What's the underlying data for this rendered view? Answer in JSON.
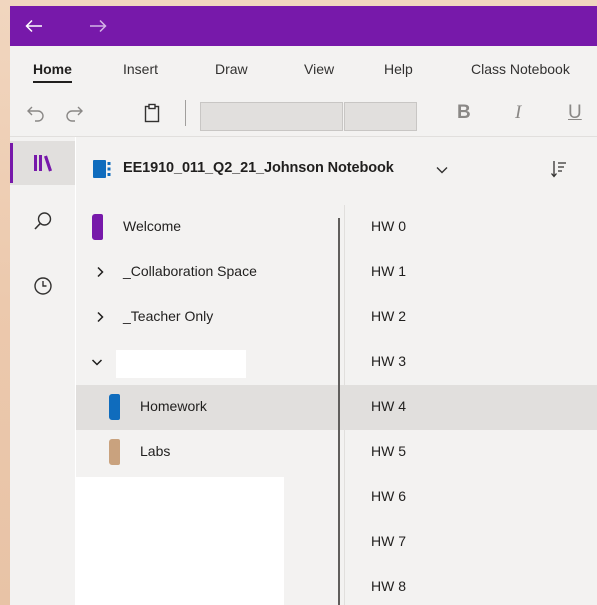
{
  "nav": {
    "back_icon": "arrow-left-icon",
    "forward_icon": "arrow-right-icon"
  },
  "ribbon": {
    "tabs": [
      {
        "label": "Home",
        "active": true
      },
      {
        "label": "Insert"
      },
      {
        "label": "Draw"
      },
      {
        "label": "View"
      },
      {
        "label": "Help"
      },
      {
        "label": "Class Notebook"
      }
    ]
  },
  "toolbar": {
    "undo_icon": "undo-icon",
    "redo_icon": "redo-icon",
    "paste_icon": "clipboard-icon",
    "font_name": "",
    "font_size": "",
    "bold_label": "B",
    "italic_label": "I",
    "underline_label": "U"
  },
  "rail": {
    "items": [
      {
        "icon": "notebooks-icon",
        "active": true
      },
      {
        "icon": "search-icon"
      },
      {
        "icon": "recent-clock-icon"
      }
    ]
  },
  "notebook": {
    "title": "EE1910_011_Q2_21_Johnson Notebook",
    "sort_icon": "sort-icon"
  },
  "sections": [
    {
      "label": "Welcome",
      "color": "#7719aa",
      "type": "section"
    },
    {
      "label": "_Collaboration Space",
      "type": "group",
      "expanded": false
    },
    {
      "label": "_Teacher Only",
      "type": "group",
      "expanded": false
    },
    {
      "label": "",
      "type": "group",
      "expanded": true
    },
    {
      "label": "Homework",
      "color": "#0f6cbd",
      "type": "section",
      "selected": true
    },
    {
      "label": "Labs",
      "color": "#c9a27e",
      "type": "section"
    }
  ],
  "pages": [
    {
      "label": "HW 0"
    },
    {
      "label": "HW 1"
    },
    {
      "label": "HW 2"
    },
    {
      "label": "HW 3"
    },
    {
      "label": "HW 4",
      "selected": true
    },
    {
      "label": "HW 5"
    },
    {
      "label": "HW 6"
    },
    {
      "label": "HW 7"
    },
    {
      "label": "HW 8"
    }
  ],
  "colors": {
    "accent": "#7719aa",
    "homework_section": "#0f6cbd",
    "labs_section": "#c9a27e",
    "welcome_section": "#7719aa"
  }
}
